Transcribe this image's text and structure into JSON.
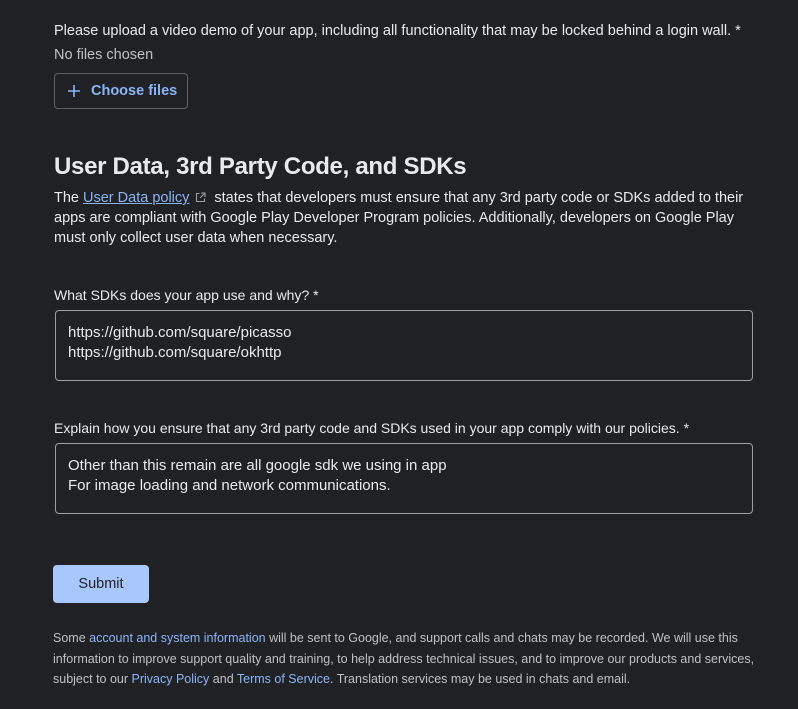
{
  "upload": {
    "prompt": "Please upload a video demo of your app, including all functionality that may be locked behind a login wall. *",
    "status": "No files chosen",
    "button_label": "Choose files",
    "button_icon": "plus-icon"
  },
  "sdk_section": {
    "title": "User Data, 3rd Party Code, and SDKs",
    "desc_prefix": "The ",
    "policy_link": "User Data policy",
    "policy_link_icon": "external-link-icon",
    "desc_suffix": "states that developers must ensure that any 3rd party code or SDKs added to their apps are compliant with Google Play Developer Program policies. Additionally, developers on Google Play must only collect user data when necessary."
  },
  "questions": [
    {
      "label": "What SDKs does your app use and why? *",
      "answer_lines": [
        "https://github.com/square/picasso",
        "https://github.com/square/okhttp"
      ]
    },
    {
      "label": "Explain how you ensure that any 3rd party code and SDKs used in your app comply with our policies. *",
      "answer_lines": [
        "Other than this remain are all google sdk we using in app",
        "For image loading and network communications."
      ]
    }
  ],
  "submit_label": "Submit",
  "footer": {
    "part1": "Some ",
    "link1": "account and system information",
    "part2": " will be sent to Google, and support calls and chats may be recorded. We will use this information to improve support quality and training, to help address technical issues, and to improve our products and services, subject to our ",
    "link2": "Privacy Policy",
    "part3": " and ",
    "link3": "Terms of Service",
    "part4": ". Translation services may be used in chats and email."
  },
  "colors": {
    "background": "#202124",
    "link": "#8ab4f8",
    "submit_bg": "#a8c7fa"
  }
}
